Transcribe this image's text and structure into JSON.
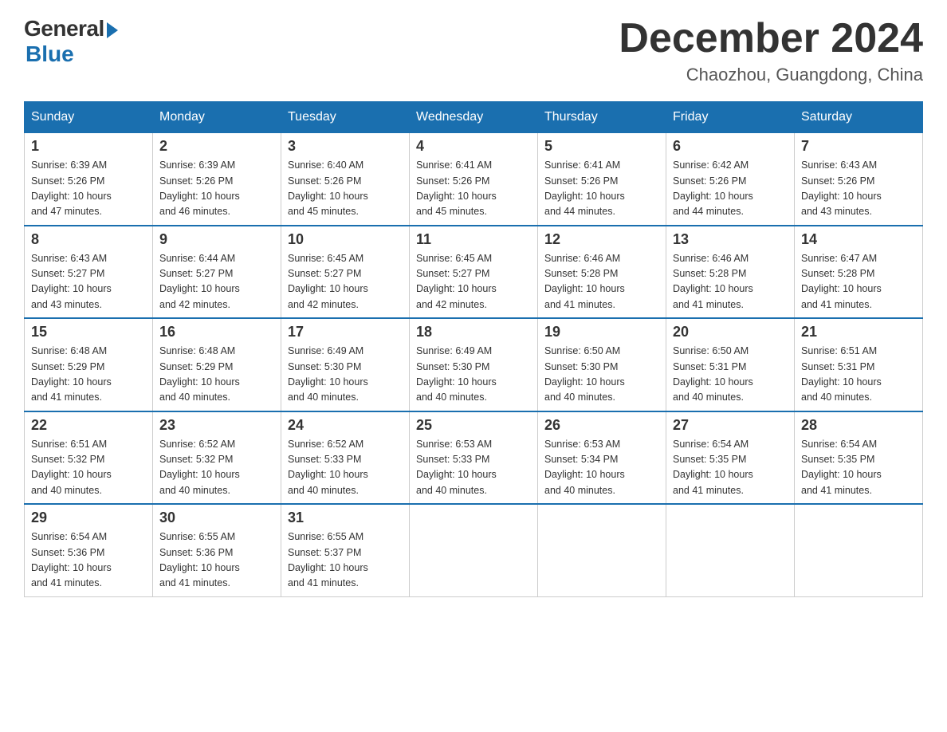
{
  "header": {
    "logo": {
      "general": "General",
      "blue": "Blue"
    },
    "title": "December 2024",
    "location": "Chaozhou, Guangdong, China"
  },
  "calendar": {
    "weekdays": [
      "Sunday",
      "Monday",
      "Tuesday",
      "Wednesday",
      "Thursday",
      "Friday",
      "Saturday"
    ],
    "weeks": [
      [
        {
          "day": 1,
          "sunrise": "6:39 AM",
          "sunset": "5:26 PM",
          "daylight": "10 hours and 47 minutes."
        },
        {
          "day": 2,
          "sunrise": "6:39 AM",
          "sunset": "5:26 PM",
          "daylight": "10 hours and 46 minutes."
        },
        {
          "day": 3,
          "sunrise": "6:40 AM",
          "sunset": "5:26 PM",
          "daylight": "10 hours and 45 minutes."
        },
        {
          "day": 4,
          "sunrise": "6:41 AM",
          "sunset": "5:26 PM",
          "daylight": "10 hours and 45 minutes."
        },
        {
          "day": 5,
          "sunrise": "6:41 AM",
          "sunset": "5:26 PM",
          "daylight": "10 hours and 44 minutes."
        },
        {
          "day": 6,
          "sunrise": "6:42 AM",
          "sunset": "5:26 PM",
          "daylight": "10 hours and 44 minutes."
        },
        {
          "day": 7,
          "sunrise": "6:43 AM",
          "sunset": "5:26 PM",
          "daylight": "10 hours and 43 minutes."
        }
      ],
      [
        {
          "day": 8,
          "sunrise": "6:43 AM",
          "sunset": "5:27 PM",
          "daylight": "10 hours and 43 minutes."
        },
        {
          "day": 9,
          "sunrise": "6:44 AM",
          "sunset": "5:27 PM",
          "daylight": "10 hours and 42 minutes."
        },
        {
          "day": 10,
          "sunrise": "6:45 AM",
          "sunset": "5:27 PM",
          "daylight": "10 hours and 42 minutes."
        },
        {
          "day": 11,
          "sunrise": "6:45 AM",
          "sunset": "5:27 PM",
          "daylight": "10 hours and 42 minutes."
        },
        {
          "day": 12,
          "sunrise": "6:46 AM",
          "sunset": "5:28 PM",
          "daylight": "10 hours and 41 minutes."
        },
        {
          "day": 13,
          "sunrise": "6:46 AM",
          "sunset": "5:28 PM",
          "daylight": "10 hours and 41 minutes."
        },
        {
          "day": 14,
          "sunrise": "6:47 AM",
          "sunset": "5:28 PM",
          "daylight": "10 hours and 41 minutes."
        }
      ],
      [
        {
          "day": 15,
          "sunrise": "6:48 AM",
          "sunset": "5:29 PM",
          "daylight": "10 hours and 41 minutes."
        },
        {
          "day": 16,
          "sunrise": "6:48 AM",
          "sunset": "5:29 PM",
          "daylight": "10 hours and 40 minutes."
        },
        {
          "day": 17,
          "sunrise": "6:49 AM",
          "sunset": "5:30 PM",
          "daylight": "10 hours and 40 minutes."
        },
        {
          "day": 18,
          "sunrise": "6:49 AM",
          "sunset": "5:30 PM",
          "daylight": "10 hours and 40 minutes."
        },
        {
          "day": 19,
          "sunrise": "6:50 AM",
          "sunset": "5:30 PM",
          "daylight": "10 hours and 40 minutes."
        },
        {
          "day": 20,
          "sunrise": "6:50 AM",
          "sunset": "5:31 PM",
          "daylight": "10 hours and 40 minutes."
        },
        {
          "day": 21,
          "sunrise": "6:51 AM",
          "sunset": "5:31 PM",
          "daylight": "10 hours and 40 minutes."
        }
      ],
      [
        {
          "day": 22,
          "sunrise": "6:51 AM",
          "sunset": "5:32 PM",
          "daylight": "10 hours and 40 minutes."
        },
        {
          "day": 23,
          "sunrise": "6:52 AM",
          "sunset": "5:32 PM",
          "daylight": "10 hours and 40 minutes."
        },
        {
          "day": 24,
          "sunrise": "6:52 AM",
          "sunset": "5:33 PM",
          "daylight": "10 hours and 40 minutes."
        },
        {
          "day": 25,
          "sunrise": "6:53 AM",
          "sunset": "5:33 PM",
          "daylight": "10 hours and 40 minutes."
        },
        {
          "day": 26,
          "sunrise": "6:53 AM",
          "sunset": "5:34 PM",
          "daylight": "10 hours and 40 minutes."
        },
        {
          "day": 27,
          "sunrise": "6:54 AM",
          "sunset": "5:35 PM",
          "daylight": "10 hours and 41 minutes."
        },
        {
          "day": 28,
          "sunrise": "6:54 AM",
          "sunset": "5:35 PM",
          "daylight": "10 hours and 41 minutes."
        }
      ],
      [
        {
          "day": 29,
          "sunrise": "6:54 AM",
          "sunset": "5:36 PM",
          "daylight": "10 hours and 41 minutes."
        },
        {
          "day": 30,
          "sunrise": "6:55 AM",
          "sunset": "5:36 PM",
          "daylight": "10 hours and 41 minutes."
        },
        {
          "day": 31,
          "sunrise": "6:55 AM",
          "sunset": "5:37 PM",
          "daylight": "10 hours and 41 minutes."
        },
        null,
        null,
        null,
        null
      ]
    ]
  }
}
